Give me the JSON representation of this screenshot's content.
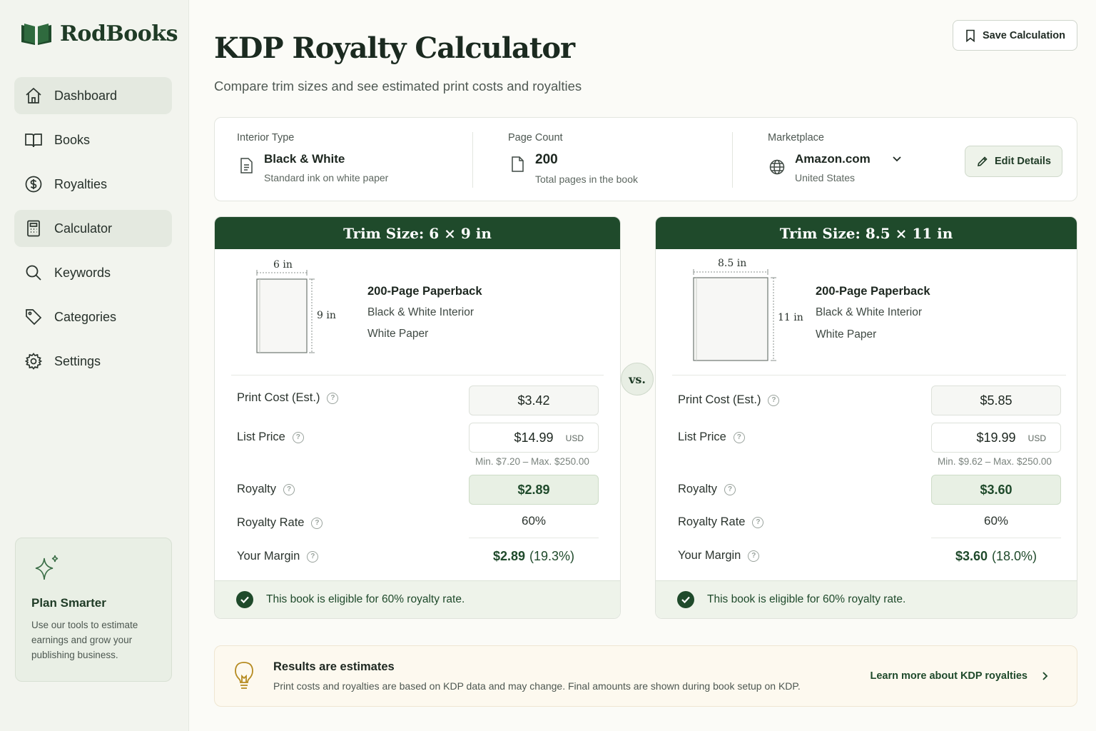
{
  "app": {
    "name": "RodBooks"
  },
  "sidebar": {
    "items": [
      {
        "label": "Dashboard",
        "icon": "home-icon",
        "active": true
      },
      {
        "label": "Books",
        "icon": "book-icon"
      },
      {
        "label": "Royalties",
        "icon": "dollar-circle-icon"
      },
      {
        "label": "Calculator",
        "icon": "calculator-icon",
        "active": true
      },
      {
        "label": "Keywords",
        "icon": "search-icon"
      },
      {
        "label": "Categories",
        "icon": "tag-icon"
      },
      {
        "label": "Settings",
        "icon": "gear-icon"
      }
    ],
    "plan": {
      "title": "Plan Smarter",
      "text": "Use our tools to estimate earnings and grow your publishing business."
    }
  },
  "header": {
    "title": "KDP Royalty Calculator",
    "subtitle": "Compare trim sizes and see estimated print costs and royalties",
    "save_label": "Save Calculation"
  },
  "details": {
    "interior": {
      "label": "Interior Type",
      "value": "Black & White",
      "sub": "Standard ink on white paper"
    },
    "pages": {
      "label": "Page Count",
      "value": "200",
      "sub": "Total pages in the book"
    },
    "marketplace": {
      "label": "Marketplace",
      "value": "Amazon.com",
      "sub": "United States"
    },
    "edit_label": "Edit Details"
  },
  "vs_label": "vs.",
  "cards": [
    {
      "header": "Trim Size: 6 × 9 in",
      "width_label": "6 in",
      "height_label": "9 in",
      "book_title": "200-Page Paperback",
      "interior": "Black & White Interior",
      "paper": "White Paper",
      "print_cost_label": "Print Cost (Est.)",
      "print_cost": "$3.42",
      "list_price_label": "List Price",
      "list_price": "$14.99",
      "currency": "USD",
      "range": "Min. $7.20  –  Max. $250.00",
      "royalty_label": "Royalty",
      "royalty": "$2.89",
      "rate_label": "Royalty Rate",
      "rate": "60%",
      "margin_label": "Your Margin",
      "margin": "$2.89",
      "margin_pct": "(19.3%)",
      "eligible": "This book is eligible for 60% royalty rate."
    },
    {
      "header": "Trim Size: 8.5 × 11 in",
      "width_label": "8.5 in",
      "height_label": "11 in",
      "book_title": "200-Page Paperback",
      "interior": "Black & White Interior",
      "paper": "White Paper",
      "print_cost_label": "Print Cost (Est.)",
      "print_cost": "$5.85",
      "list_price_label": "List Price",
      "list_price": "$19.99",
      "currency": "USD",
      "range": "Min. $9.62  –  Max. $250.00",
      "royalty_label": "Royalty",
      "royalty": "$3.60",
      "rate_label": "Royalty Rate",
      "rate": "60%",
      "margin_label": "Your Margin",
      "margin": "$3.60",
      "margin_pct": "(18.0%)",
      "eligible": "This book is eligible for 60% royalty rate."
    }
  ],
  "notice": {
    "title": "Results are estimates",
    "text": "Print costs and royalties are based on KDP data and may change. Final amounts are shown during book setup on KDP.",
    "link": "Learn more about KDP royalties"
  },
  "colors": {
    "brand": "#1f4a2b",
    "accent_bg": "#e8f0e4",
    "notice_bg": "#fdf9ef"
  }
}
